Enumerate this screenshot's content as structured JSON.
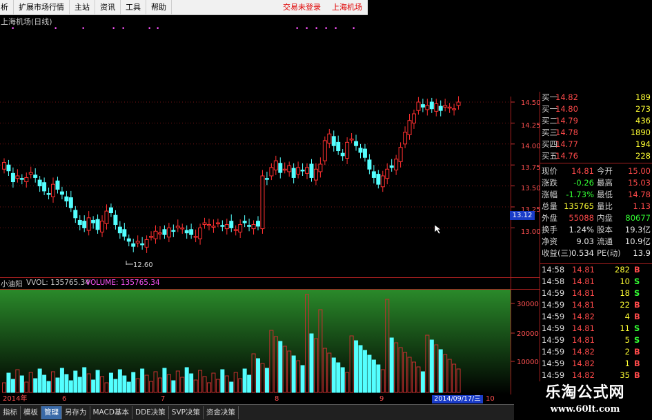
{
  "menu": {
    "items": [
      "析",
      "扩展市场行情",
      "主站",
      "资讯",
      "工具",
      "帮助"
    ],
    "trade_login": "交易未登录",
    "stock_name": "上海机场"
  },
  "chart": {
    "title": "上海机场(日线)",
    "low_marker": "12.60",
    "price_axis": [
      "14.50",
      "14.25",
      "14.00",
      "13.75",
      "13.50",
      "13.25",
      "13.00"
    ],
    "price_tag": "13.12",
    "volume_axis": [
      "30000",
      "20000",
      "10000"
    ],
    "indicator_name": "小油阳",
    "vvol_label": "VVOL: 135765.34",
    "volume_label": "VOLUME: 135765.34",
    "dates": [
      "2014年",
      "6",
      "7",
      "8",
      "9",
      "10"
    ],
    "date_tag": "2014/09/17/三",
    "colors": {
      "up": "#ff3030",
      "down": "#54ffff",
      "volume_bg_top": "#2a8a2a"
    }
  },
  "chart_data": {
    "type": "candlestick",
    "title": "上海机场(日线)",
    "ylim": [
      12.6,
      14.5
    ],
    "y_ticks": [
      13.0,
      13.25,
      13.5,
      13.75,
      14.0,
      14.25,
      14.5
    ],
    "volume_ylim": [
      0,
      35000
    ],
    "volume_ticks": [
      10000,
      20000,
      30000
    ],
    "annotation": "12.60",
    "last_volume": 135765.34
  },
  "quote": {
    "bids_top": {
      "label": "买一",
      "price": "14.82",
      "vol": "189"
    },
    "levels": [
      {
        "label": "买一",
        "price": "14.80",
        "vol": "273"
      },
      {
        "label": "买二",
        "price": "14.79",
        "vol": "436"
      },
      {
        "label": "买三",
        "price": "14.78",
        "vol": "1890"
      },
      {
        "label": "买四",
        "price": "14.77",
        "vol": "194"
      },
      {
        "label": "买五",
        "price": "14.76",
        "vol": "228"
      }
    ],
    "stats": [
      {
        "l1": "现价",
        "v1": "14.81",
        "c1": "red",
        "l2": "今开",
        "v2": "15.00",
        "c2": "red"
      },
      {
        "l1": "涨跌",
        "v1": "-0.26",
        "c1": "grn",
        "l2": "最高",
        "v2": "15.03",
        "c2": "red"
      },
      {
        "l1": "涨幅",
        "v1": "-1.73%",
        "c1": "grn",
        "l2": "最低",
        "v2": "14.78",
        "c2": "red"
      },
      {
        "l1": "总量",
        "v1": "135765",
        "c1": "yel",
        "l2": "量比",
        "v2": "1.13",
        "c2": "red"
      },
      {
        "l1": "外盘",
        "v1": "55088",
        "c1": "red",
        "l2": "内盘",
        "v2": "80677",
        "c2": "grn"
      },
      {
        "l1": "换手",
        "v1": "1.24%",
        "c1": "wht",
        "l2": "股本",
        "v2": "19.3亿",
        "c2": "wht"
      },
      {
        "l1": "净资",
        "v1": "9.03",
        "c1": "wht",
        "l2": "流通",
        "v2": "10.9亿",
        "c2": "wht"
      },
      {
        "l1": "收益(三)",
        "v1": "0.534",
        "c1": "wht",
        "l2": "PE(动)",
        "v2": "13.9",
        "c2": "wht"
      }
    ]
  },
  "ticks": [
    {
      "time": "14:58",
      "price": "14.81",
      "vol": "282",
      "side": "B"
    },
    {
      "time": "14:58",
      "price": "14.81",
      "vol": "10",
      "side": "S"
    },
    {
      "time": "14:59",
      "price": "14.81",
      "vol": "18",
      "side": "S"
    },
    {
      "time": "14:59",
      "price": "14.81",
      "vol": "22",
      "side": "B"
    },
    {
      "time": "14:59",
      "price": "14.82",
      "vol": "4",
      "side": "B"
    },
    {
      "time": "14:59",
      "price": "14.81",
      "vol": "11",
      "side": "S"
    },
    {
      "time": "14:59",
      "price": "14.81",
      "vol": "5",
      "side": "S"
    },
    {
      "time": "14:59",
      "price": "14.82",
      "vol": "2",
      "side": "B"
    },
    {
      "time": "14:59",
      "price": "14.82",
      "vol": "1",
      "side": "B"
    },
    {
      "time": "14:59",
      "price": "14.82",
      "vol": "35",
      "side": "B"
    }
  ],
  "tabs": [
    "指标",
    "模板",
    "管理",
    "另存为",
    "MACD基本",
    "DDE决策",
    "SVP决策",
    "资金决策"
  ],
  "active_tab": "管理",
  "watermark": {
    "title": "乐淘公式网",
    "url": "www.60lt.com"
  }
}
